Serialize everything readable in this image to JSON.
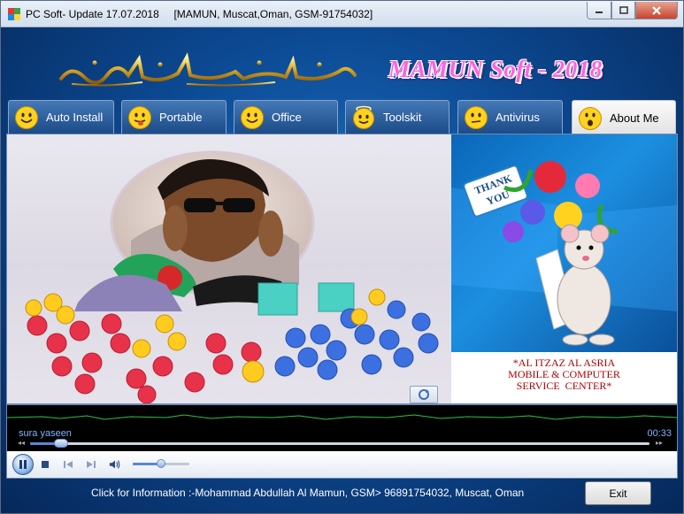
{
  "window": {
    "title": "PC Soft- Update 17.07.2018     [MAMUN, Muscat,Oman, GSM-91754032]",
    "app_icon": "colorful-app-icon"
  },
  "header": {
    "calligraphy_icon": "bismillah-calligraphy",
    "brand": "MAMUN Soft - 2018"
  },
  "tabs": [
    {
      "label": "Auto Install",
      "icon": "smiley-icon"
    },
    {
      "label": "Portable",
      "icon": "tongue-smiley-icon"
    },
    {
      "label": "Office",
      "icon": "smiley-icon"
    },
    {
      "label": "Toolskit",
      "icon": "angel-smiley-icon"
    },
    {
      "label": "Antivirus",
      "icon": "neutral-smiley-icon"
    },
    {
      "label": "About Me",
      "icon": "surprised-smiley-icon",
      "active": true
    }
  ],
  "content": {
    "photo": "profile-photo-with-emoji-reactions",
    "thanks_art": "thank-you-mouse-with-flowers",
    "info_lines": [
      "*AL ITZAZ AL ASRIA",
      "MOBILE & COMPUTER",
      "SERVICE  CENTER*"
    ]
  },
  "player": {
    "track": "sura yaseen",
    "time": "00:33",
    "progress": 0.05,
    "volume": 0.5
  },
  "footer": {
    "info": "Click for Information :-Mohammad Abdullah Al Mamun, GSM> 96891754032, Muscat, Oman",
    "exit_label": "Exit"
  },
  "colors": {
    "brand_text": "#ff63e2",
    "info_text": "#b00000",
    "background": "#0c4a94"
  }
}
